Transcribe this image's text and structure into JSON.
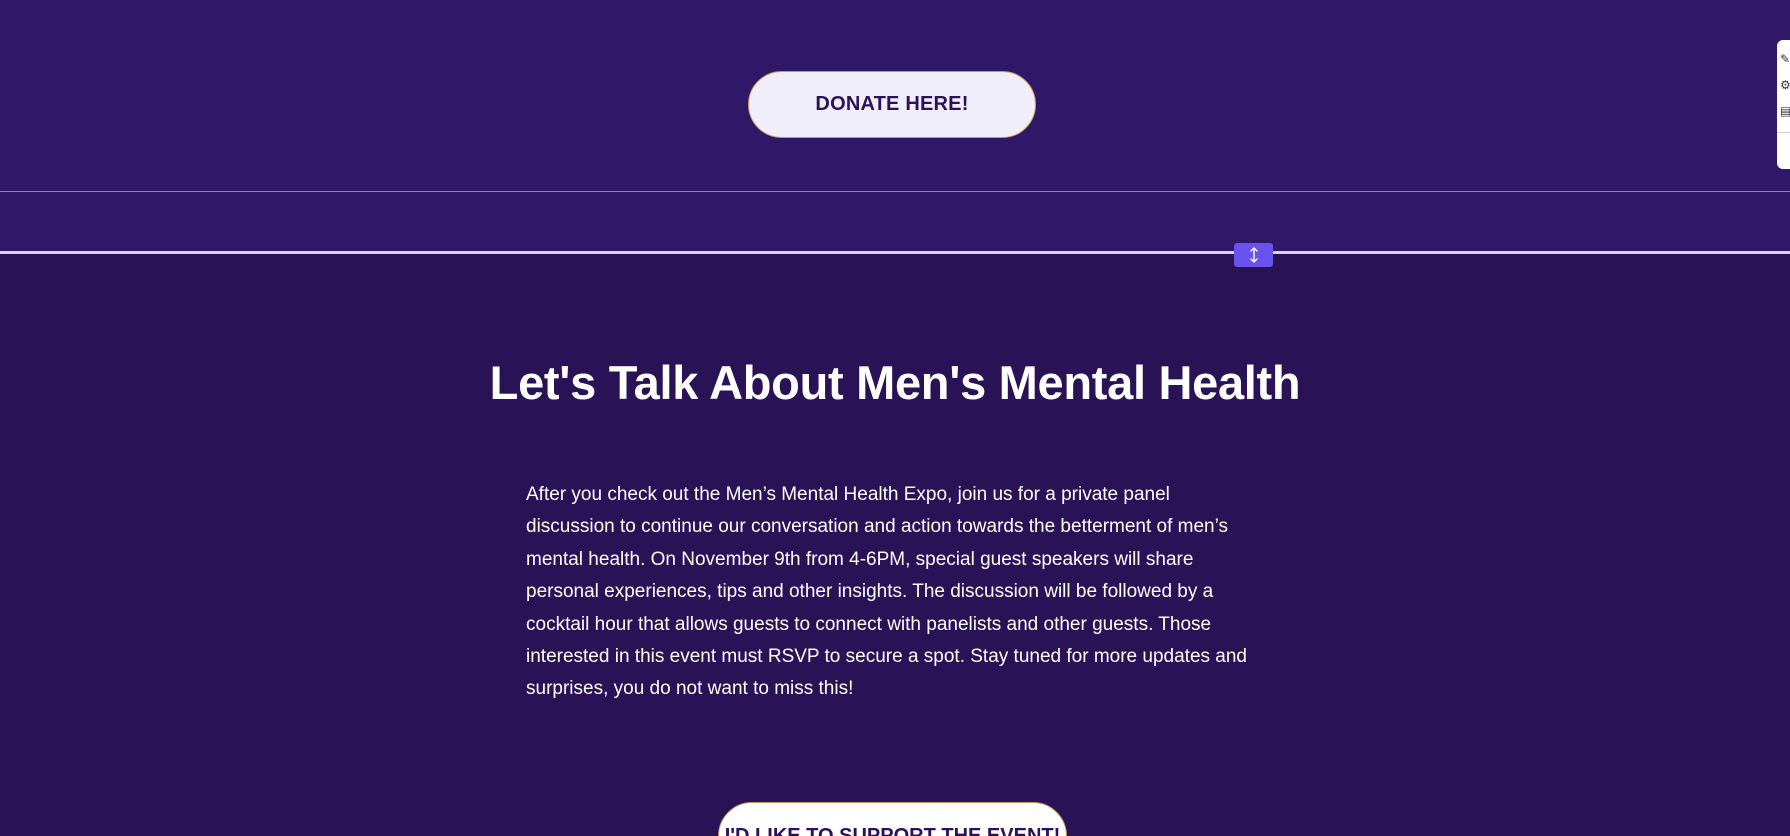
{
  "donate": {
    "label": "DONATE HERE!"
  },
  "section": {
    "heading": "Let's Talk About Men's Mental Health",
    "body": "After you check out the Men’s Mental Health Expo, join us for a private panel discussion to continue our conversation and action towards the betterment of men’s mental health. On November 9th from 4-6PM, special guest speakers will share personal experiences, tips and other insights. The discussion will be followed by a cocktail hour that allows guests to connect with panelists and other guests. Those interested in this event must RSVP to secure a spot. Stay tuned for more updates and surprises, you do not want to miss this!",
    "support_label": "I'D LIKE TO SUPPORT THE EVENT!"
  },
  "editor": {
    "resize_handle_icon": "vertical-resize-icon",
    "side_tools": [
      "edit-icon",
      "settings-icon",
      "layout-icon"
    ]
  },
  "colors": {
    "top_background": "#2f1867",
    "main_background": "#2a1256",
    "button_background": "#f1eefc",
    "button_text": "#2b1259",
    "button_border": "#c79b55",
    "handle_accent": "#6a52ee",
    "divider": "#d9d4f5"
  }
}
